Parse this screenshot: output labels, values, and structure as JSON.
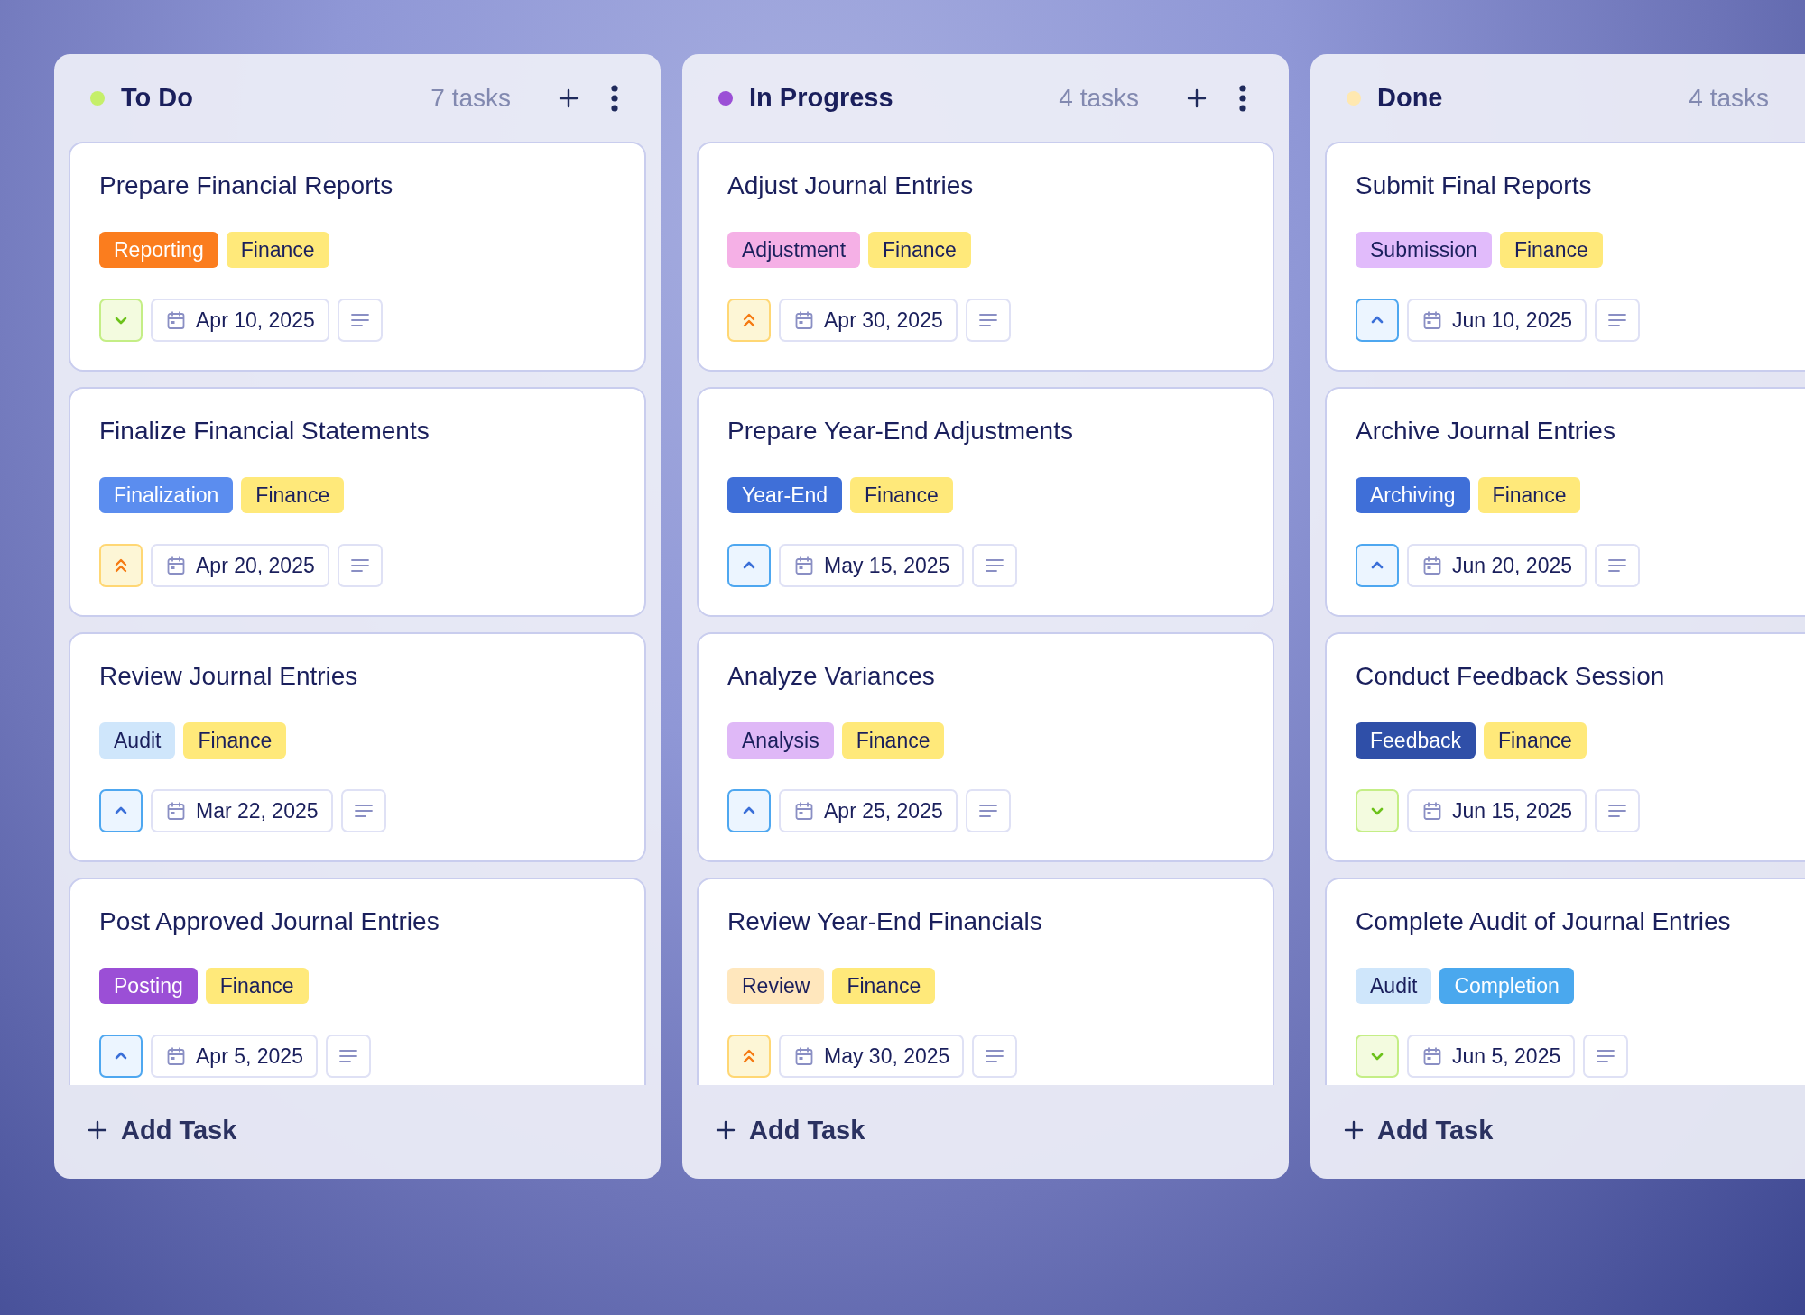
{
  "columns": [
    {
      "title": "To Do",
      "color": "#c5ef6a",
      "count": "7 tasks",
      "has_menu": true,
      "add_task": "Add Task",
      "cards": [
        {
          "title": "Prepare Financial Reports",
          "tags": [
            {
              "label": "Reporting",
              "color": "#fb7d1e"
            },
            {
              "label": "Finance",
              "color": "#ffe97a"
            }
          ],
          "priority": {
            "kind": "low"
          },
          "date": "Apr 10, 2025"
        },
        {
          "title": "Finalize Financial Statements",
          "tags": [
            {
              "label": "Finalization",
              "color": "#5b8def"
            },
            {
              "label": "Finance",
              "color": "#ffe97a"
            }
          ],
          "priority": {
            "kind": "high"
          },
          "date": "Apr 20, 2025"
        },
        {
          "title": "Review Journal Entries",
          "tags": [
            {
              "label": "Audit",
              "color": "#cfe6fb"
            },
            {
              "label": "Finance",
              "color": "#ffe97a"
            }
          ],
          "priority": {
            "kind": "medium"
          },
          "date": "Mar 22, 2025"
        },
        {
          "title": "Post Approved Journal Entries",
          "tags": [
            {
              "label": "Posting",
              "color": "#9b4fd6"
            },
            {
              "label": "Finance",
              "color": "#ffe97a"
            }
          ],
          "priority": {
            "kind": "medium"
          },
          "date": "Apr 5, 2025"
        }
      ]
    },
    {
      "title": "In Progress",
      "color": "#9b4fd6",
      "count": "4 tasks",
      "has_menu": true,
      "add_task": "Add Task",
      "cards": [
        {
          "title": "Adjust Journal Entries",
          "tags": [
            {
              "label": "Adjustment",
              "color": "#f5b0e6"
            },
            {
              "label": "Finance",
              "color": "#ffe97a"
            }
          ],
          "priority": {
            "kind": "high"
          },
          "date": "Apr 30, 2025"
        },
        {
          "title": "Prepare Year-End Adjustments",
          "tags": [
            {
              "label": "Year-End",
              "color": "#3f6fd8"
            },
            {
              "label": "Finance",
              "color": "#ffe97a"
            }
          ],
          "priority": {
            "kind": "medium"
          },
          "date": "May 15, 2025"
        },
        {
          "title": "Analyze Variances",
          "tags": [
            {
              "label": "Analysis",
              "color": "#dfb8f7"
            },
            {
              "label": "Finance",
              "color": "#ffe97a"
            }
          ],
          "priority": {
            "kind": "medium"
          },
          "date": "Apr 25, 2025"
        },
        {
          "title": "Review Year-End Financials",
          "tags": [
            {
              "label": "Review",
              "color": "#ffe7bd"
            },
            {
              "label": "Finance",
              "color": "#ffe97a"
            }
          ],
          "priority": {
            "kind": "high"
          },
          "date": "May 30, 2025"
        }
      ]
    },
    {
      "title": "Done",
      "color": "#ffe8b0",
      "count": "4 tasks",
      "has_menu": false,
      "add_task": "Add Task",
      "cards": [
        {
          "title": "Submit Final Reports",
          "tags": [
            {
              "label": "Submission",
              "color": "#e1bbfb"
            },
            {
              "label": "Finance",
              "color": "#ffe97a"
            }
          ],
          "priority": {
            "kind": "medium"
          },
          "date": "Jun 10, 2025"
        },
        {
          "title": "Archive Journal Entries",
          "tags": [
            {
              "label": "Archiving",
              "color": "#3f6fd8"
            },
            {
              "label": "Finance",
              "color": "#ffe97a"
            }
          ],
          "priority": {
            "kind": "medium"
          },
          "date": "Jun 20, 2025"
        },
        {
          "title": "Conduct Feedback Session",
          "tags": [
            {
              "label": "Feedback",
              "color": "#2f4fa8"
            },
            {
              "label": "Finance",
              "color": "#ffe97a"
            }
          ],
          "priority": {
            "kind": "low"
          },
          "date": "Jun 15, 2025"
        },
        {
          "title": "Complete Audit of Journal Entries",
          "tags": [
            {
              "label": "Audit",
              "color": "#cfe6fb"
            },
            {
              "label": "Completion",
              "color": "#4aa8ee"
            }
          ],
          "priority": {
            "kind": "low"
          },
          "date": "Jun 5, 2025"
        }
      ]
    }
  ]
}
